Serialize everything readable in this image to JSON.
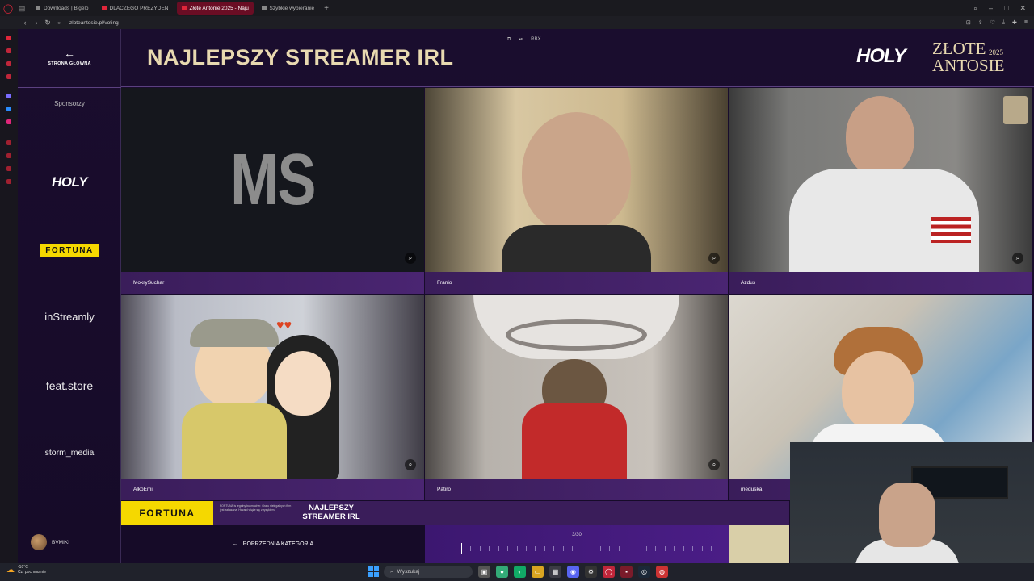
{
  "browser": {
    "tabs": [
      {
        "label": "Downloads | Bigelo",
        "active": false
      },
      {
        "label": "DLACZEGO PREZYDENT",
        "active": false
      },
      {
        "label": "Złote Antonie 2025 - Naju",
        "active": true
      },
      {
        "label": "Szybkie wybieranie",
        "active": false
      }
    ],
    "url": "zloteantosie.pl/voting"
  },
  "sidebar": {
    "home_label": "STRONA GŁÓWNA",
    "sponsors_label": "Sponsorzy",
    "sponsors": [
      "HOLY",
      "FORTUNA",
      "inStreamly",
      "feat.store",
      "storm_media"
    ],
    "user_name": "BVMIKI"
  },
  "header": {
    "category_title": "NAJLEPSZY STREAMER IRL",
    "media_controls": [
      "⧉",
      "⏯",
      "RBX"
    ],
    "brand_holy": "HOLY",
    "brand_zlote": "ZŁOTE",
    "brand_antosie": "ANTOSIE",
    "brand_year": "2025"
  },
  "nominees": [
    {
      "name": "MokrySuchar",
      "image_text": "MS"
    },
    {
      "name": "Franio"
    },
    {
      "name": "Azdus"
    },
    {
      "name": "AlkoEmil"
    },
    {
      "name": "Patiro"
    },
    {
      "name": "meduska"
    }
  ],
  "footer": {
    "fortuna_logo": "FORTUNA",
    "fortuna_small": "FORTUNA is legalny bukmacher. Gra u nielegalnych firm jest zakazana. Hazard wiąże się z ryzykiem.",
    "fortuna_cat_line1": "NAJLEPSZY",
    "fortuna_cat_line2": "STREAMER IRL",
    "prev_category": "POPRZEDNIA KATEGORIA",
    "progress_label": "3/30",
    "progress_current": 3,
    "progress_total": 30
  },
  "taskbar": {
    "weather_temp": "-10°C",
    "weather_desc": "Cz. pochmurnie",
    "search_placeholder": "Wyszukaj"
  },
  "colors": {
    "accent_gold": "#e8d9b0",
    "fortuna_yellow": "#f5d800",
    "purple_bar": "#3a1d5a"
  }
}
